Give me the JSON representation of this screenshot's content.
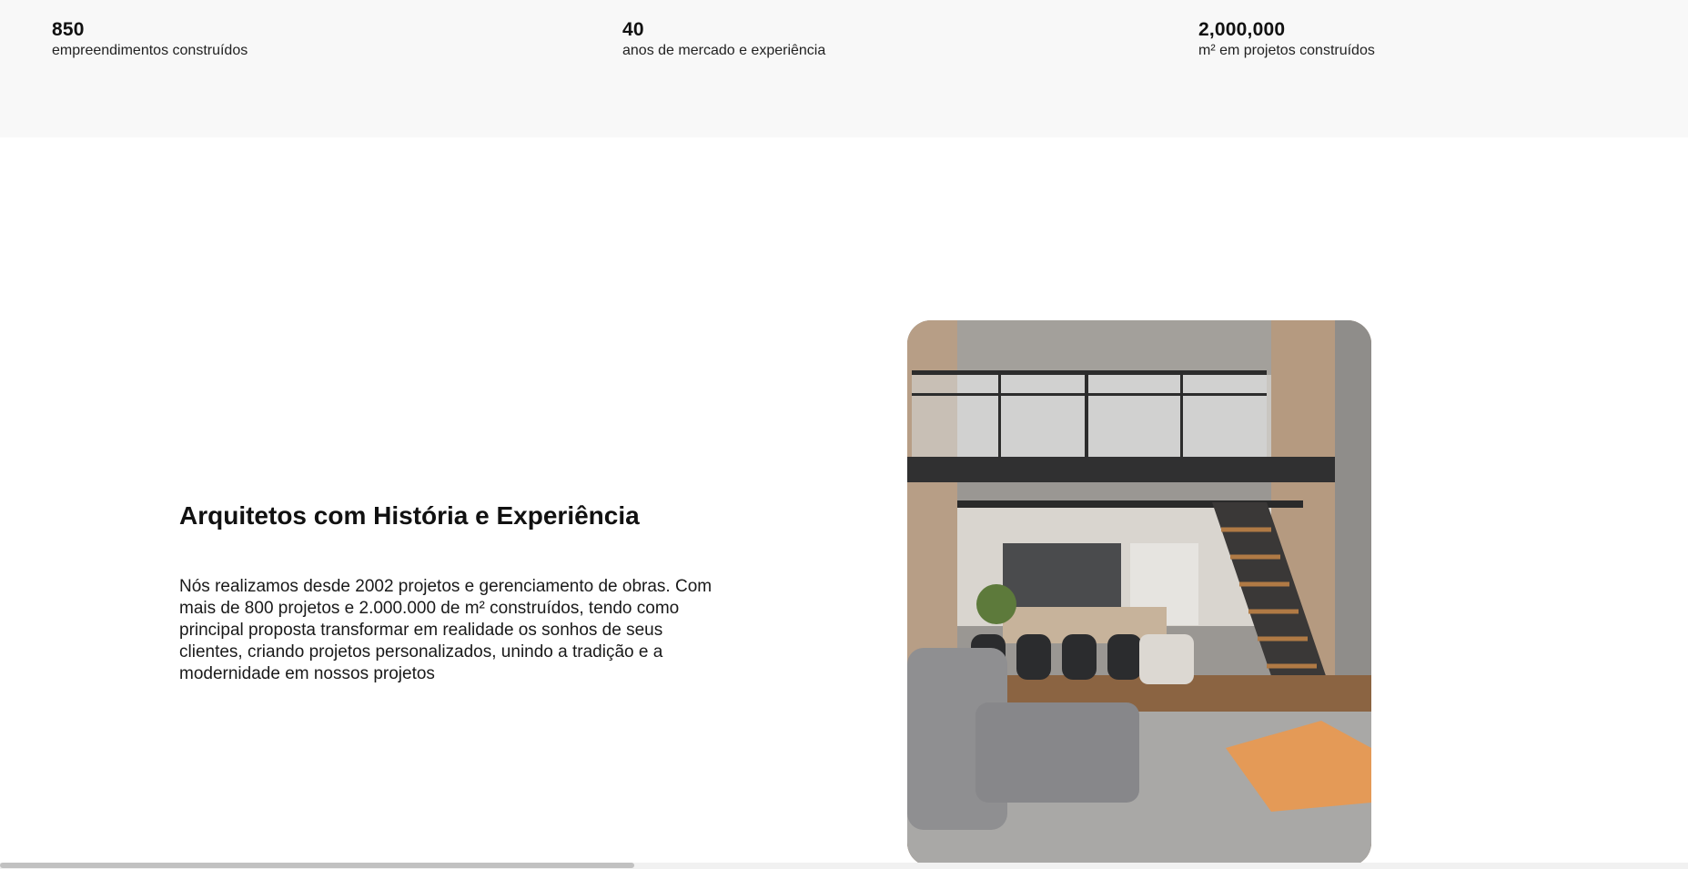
{
  "stats": [
    {
      "value": "850",
      "label": "empreendimentos construídos"
    },
    {
      "value": "40",
      "label": "anos de mercado e experiência"
    },
    {
      "value": "2,000,000",
      "label": "m² em projetos construídos"
    }
  ],
  "about": {
    "title": "Arquitetos com História e Experiência",
    "text": "Nós realizamos desde 2002 projetos e gerenciamento de obras. Com mais de 800 projetos e 2.000.000 de m² construídos, tendo como principal proposta transformar em realidade os sonhos de seus clientes, criando projetos personalizados, unindo a tradição e a modernidade em nossos projetos"
  },
  "colors": {
    "band_background": "#f8f8f8",
    "text": "#111111"
  },
  "scrollbar": {
    "position_fraction": 0.0,
    "visible_fraction": 0.376
  }
}
